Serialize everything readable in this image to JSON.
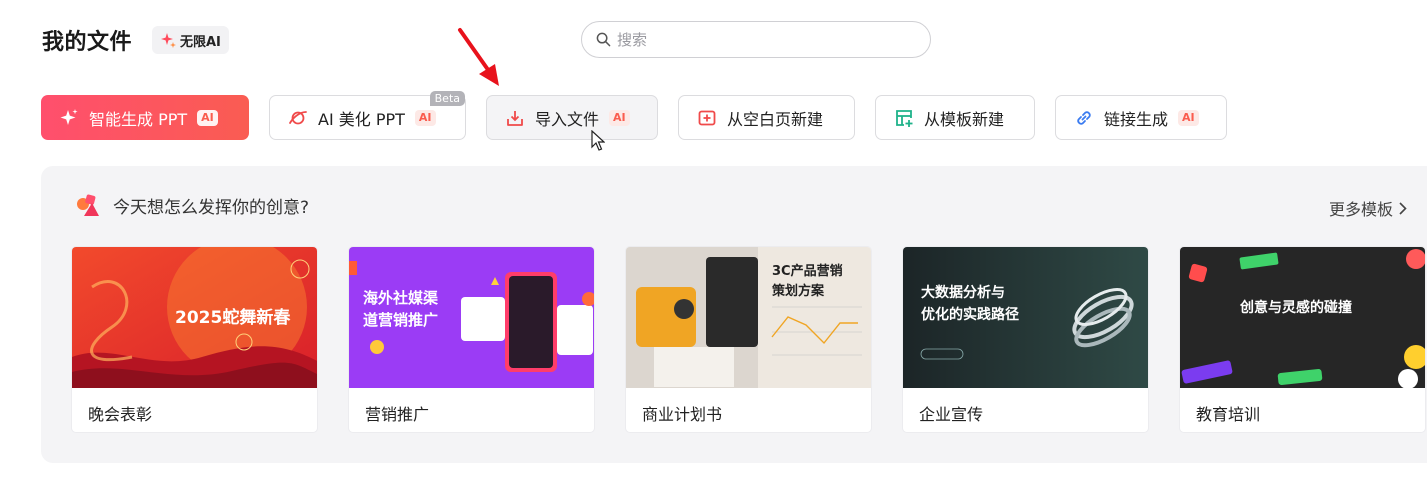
{
  "header": {
    "title": "我的文件",
    "ai_tag": "无限AI",
    "search_placeholder": "搜索"
  },
  "actions": [
    {
      "label": "智能生成 PPT",
      "ai": "AI"
    },
    {
      "label": "AI 美化 PPT",
      "ai": "AI",
      "badge": "Beta"
    },
    {
      "label": "导入文件",
      "ai": "AI"
    },
    {
      "label": "从空白页新建"
    },
    {
      "label": "从模板新建"
    },
    {
      "label": "链接生成",
      "ai": "AI"
    }
  ],
  "panel": {
    "title": "今天想怎么发挥你的创意?",
    "more": "更多模板",
    "templates": [
      {
        "label": "晚会表彰",
        "thumb_title": "2025蛇舞新春"
      },
      {
        "label": "营销推广",
        "thumb_title_1": "海外社媒渠",
        "thumb_title_2": "道营销推广"
      },
      {
        "label": "商业计划书",
        "thumb_title_1": "3C产品营销",
        "thumb_title_2": "策划方案"
      },
      {
        "label": "企业宣传",
        "thumb_title_1": "大数据分析与",
        "thumb_title_2": "优化的实践路径"
      },
      {
        "label": "教育培训",
        "thumb_title": "创意与灵感的碰撞"
      }
    ]
  },
  "colors": {
    "primary_gradient_start": "#ff4f6d",
    "primary_gradient_end": "#fa5c52",
    "ai_badge": "#fa5c4e",
    "annotation_arrow": "#e8121c"
  }
}
